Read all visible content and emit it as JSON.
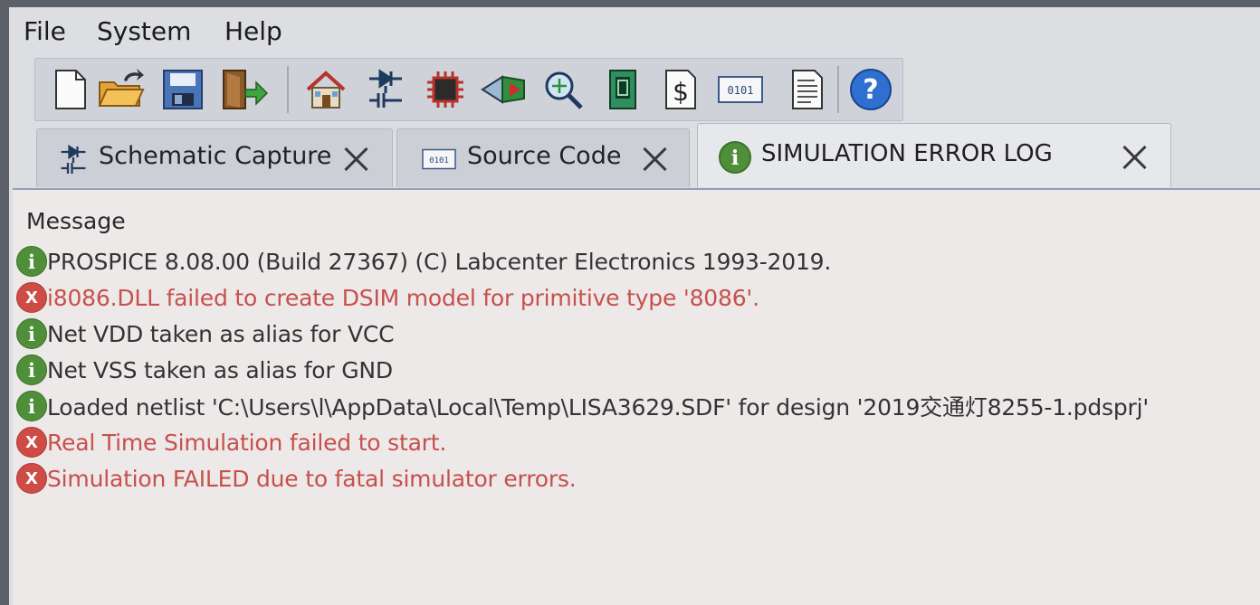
{
  "menu": [
    "File",
    "System",
    "Help"
  ],
  "toolbar": {
    "icons": [
      "new-file-icon",
      "open-folder-icon",
      "save-icon",
      "exit-icon",
      "home-icon",
      "schematic-icon",
      "chip-icon",
      "gerber-icon",
      "zoom-icon",
      "pcb-icon",
      "bill-icon",
      "source-code-icon",
      "report-icon",
      "help-icon"
    ]
  },
  "tabs": [
    {
      "label": "Schematic Capture",
      "icon": "schematic-icon",
      "active": false
    },
    {
      "label": "Source Code",
      "icon": "source-code-icon",
      "active": false
    },
    {
      "label": "SIMULATION ERROR LOG",
      "icon": "info-icon",
      "active": true
    }
  ],
  "log": {
    "header": "Message",
    "rows": [
      {
        "type": "info",
        "text": "PROSPICE 8.08.00 (Build 27367) (C) Labcenter Electronics 1993-2019."
      },
      {
        "type": "error",
        "text": "i8086.DLL failed to create DSIM model for primitive type '8086'."
      },
      {
        "type": "info",
        "text": "Net VDD taken as alias for VCC"
      },
      {
        "type": "info",
        "text": "Net VSS taken as alias for GND"
      },
      {
        "type": "info",
        "text": "Loaded netlist 'C:\\Users\\l\\AppData\\Local\\Temp\\LISA3629.SDF' for design '2019交通灯8255-1.pdsprj'"
      },
      {
        "type": "error",
        "text": "Real Time Simulation failed to start."
      },
      {
        "type": "error",
        "text": "Simulation FAILED due to fatal simulator errors."
      }
    ]
  },
  "icon_glyphs": {
    "info": "i",
    "error": "X",
    "help": "?",
    "source_code": "0101"
  },
  "colors": {
    "info_icon": "#4f8f3a",
    "error_icon": "#cf4b45",
    "error_text": "#c7504c",
    "help_icon": "#2f6fd0"
  }
}
